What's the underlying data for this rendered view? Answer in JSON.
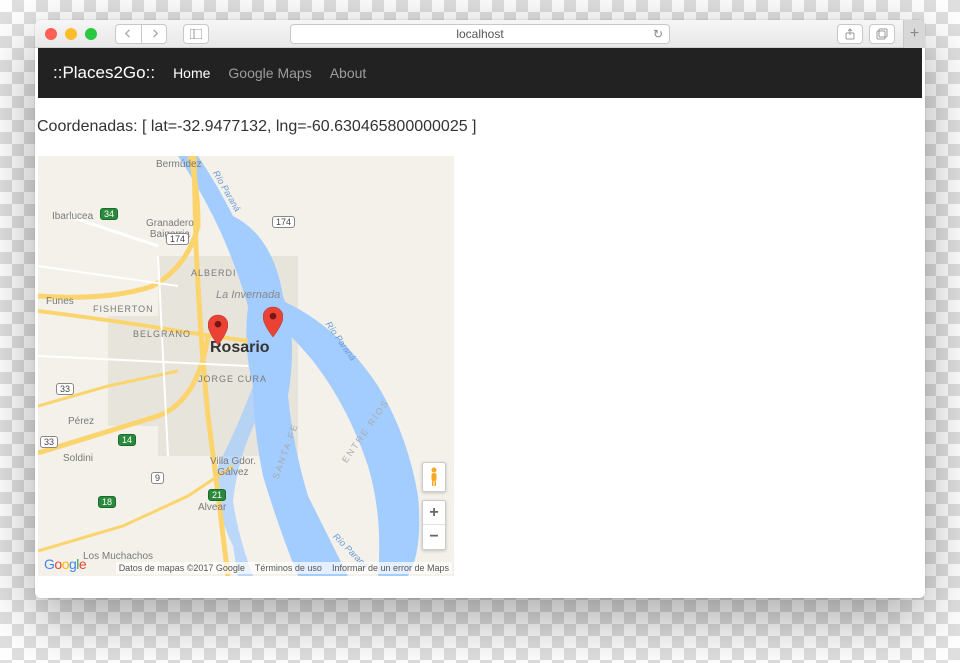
{
  "browser": {
    "url": "localhost"
  },
  "nav": {
    "brand": "::Places2Go::",
    "links": [
      {
        "label": "Home",
        "active": true
      },
      {
        "label": "Google Maps",
        "active": false
      },
      {
        "label": "About",
        "active": false
      }
    ]
  },
  "coords": {
    "prefix": "Coordenadas: [ ",
    "lat_label": "lat=",
    "lat_value": "-32.9477132",
    "sep": ", ",
    "lng_label": "lng=",
    "lng_value": "-60.630465800000025",
    "suffix": " ]"
  },
  "map": {
    "center_city": "Rosario",
    "labels": {
      "bermudez": "Bermúdez",
      "ibarlucea": "Ibarlucea",
      "granadero": "Granadero\nBaigorria",
      "alberdi": "ALBERDI",
      "fisherton": "FISHERTON",
      "belgrano": "BELGRANO",
      "funes": "Funes",
      "la_invernada": "La Invernada",
      "jorge_cura": "JORGE CURA",
      "perez": "Pérez",
      "soldini": "Soldini",
      "villa_gdor": "Villa Gdor.\nGálvez",
      "alvear": "Alvear",
      "los_muchachos": "Los Muchachos",
      "rio_parana_top": "Río Paraná",
      "rio_parana_mid": "Río Paraná",
      "rio_parana_bot": "Río Paraná",
      "santa_fe": "SANTA FE",
      "entre_rios": "ENTRE RÍOS"
    },
    "shields": {
      "s34": "34",
      "s174_a": "174",
      "s174_b": "174",
      "s33_a": "33",
      "s33_b": "33",
      "g14": "14",
      "g18": "18",
      "g21": "21",
      "s9": "9"
    },
    "markers": [
      {
        "id": "marker-1"
      },
      {
        "id": "marker-2"
      }
    ],
    "controls": {
      "zoom_in": "+",
      "zoom_out": "−"
    },
    "logo": [
      "G",
      "o",
      "o",
      "g",
      "l",
      "e"
    ],
    "footer": {
      "attribution": "Datos de mapas ©2017 Google",
      "terms": "Términos de uso",
      "report": "Informar de un error de Maps"
    }
  }
}
